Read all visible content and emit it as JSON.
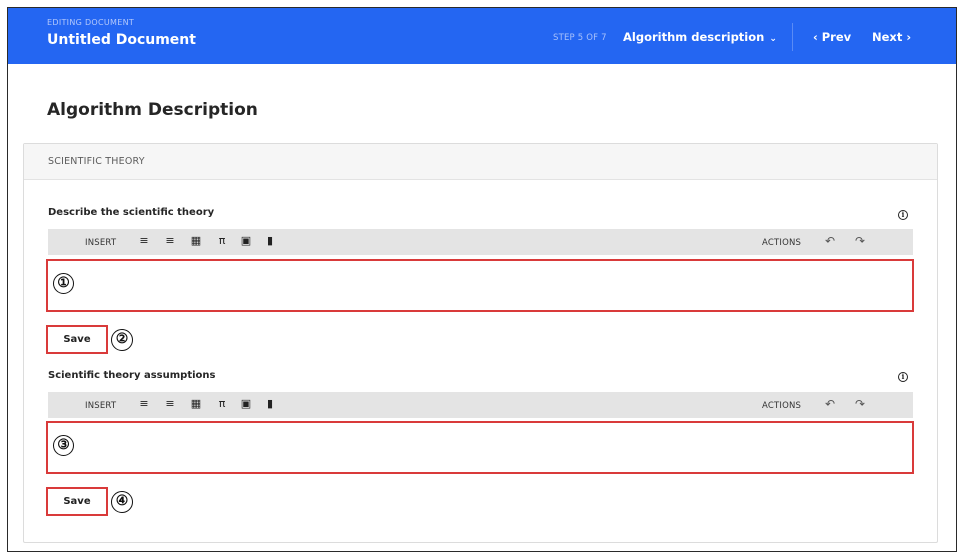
{
  "topbar": {
    "eyebrow": "EDITING DOCUMENT",
    "doc_title": "Untitled Document",
    "step": "STEP 5 OF 7",
    "section": "Algorithm description",
    "prev": "‹ Prev",
    "next": "Next ›",
    "color": "#2466f2"
  },
  "page": {
    "title": "Algorithm Description"
  },
  "panel": {
    "header": "SCIENTIFIC THEORY"
  },
  "fields": [
    {
      "label": "Describe the scientific theory",
      "toolbar": {
        "insert": "INSERT",
        "actions": "ACTIONS"
      },
      "editor_marker": "①",
      "save_label": "Save",
      "save_marker": "②"
    },
    {
      "label": "Scientific theory assumptions",
      "toolbar": {
        "insert": "INSERT",
        "actions": "ACTIONS"
      },
      "editor_marker": "③",
      "save_label": "Save",
      "save_marker": "④"
    }
  ],
  "icons": {
    "toolbar": [
      "bulleted-list-icon",
      "numbered-list-icon",
      "table-icon",
      "pi-icon",
      "image-icon",
      "bookmark-icon"
    ],
    "undo": "undo-icon",
    "redo": "redo-icon",
    "info": "info-icon"
  },
  "highlight_color": "#d93a3a"
}
